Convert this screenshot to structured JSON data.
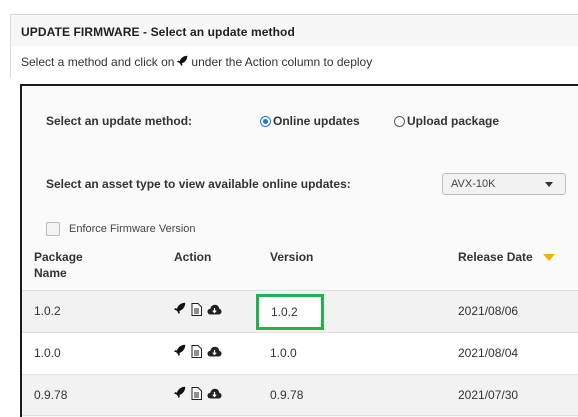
{
  "header": {
    "title": "UPDATE FIRMWARE - Select an update method",
    "subtitle_before": "Select a method and click on",
    "subtitle_after": "under the Action column to deploy",
    "subtitle_icon": "rocket-icon"
  },
  "method": {
    "label": "Select an update method:",
    "options": [
      {
        "label": "Online updates",
        "selected": true
      },
      {
        "label": "Upload package",
        "selected": false
      }
    ]
  },
  "asset": {
    "label": "Select an asset type to view available online updates:",
    "selected_value": "AVX-10K"
  },
  "enforce": {
    "label": "Enforce Firmware Version",
    "checked": false
  },
  "table": {
    "headers": {
      "package": "Package Name",
      "action": "Action",
      "version": "Version",
      "release": "Release Date"
    },
    "sort": {
      "column": "release",
      "direction": "descending",
      "icon": "sort-desc-icon",
      "color": "#f0b400"
    },
    "action_icons": [
      "rocket-icon",
      "document-icon",
      "cloud-icon"
    ],
    "rows": [
      {
        "package": "1.0.2",
        "version": "1.0.2",
        "release": "2021/08/06",
        "highlighted": true
      },
      {
        "package": "1.0.0",
        "version": "1.0.0",
        "release": "2021/08/04",
        "highlighted": false
      },
      {
        "package": "0.9.78",
        "version": "0.9.78",
        "release": "2021/07/30",
        "highlighted": false
      }
    ]
  },
  "colors": {
    "highlight": "#22b14c",
    "radio_selected": "#1a73e8"
  }
}
